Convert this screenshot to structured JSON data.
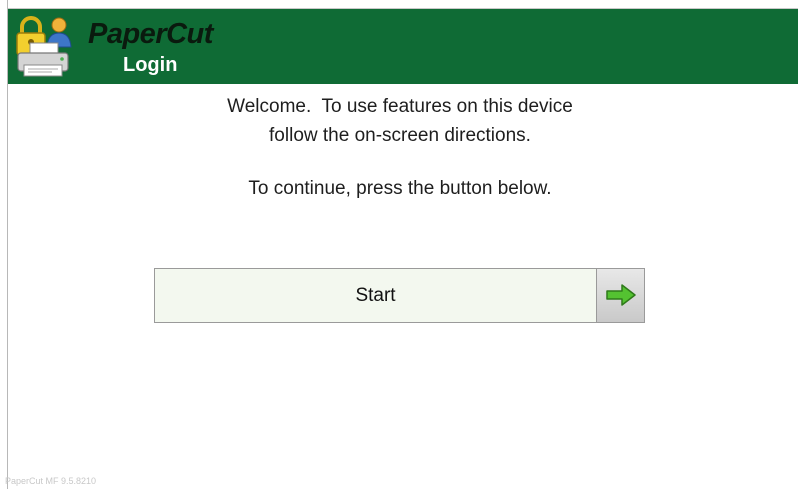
{
  "header": {
    "brand": "PaperCut",
    "title": "Login",
    "logo_icon": "papercut-printer-logo-icon"
  },
  "main": {
    "welcome_line1": "Welcome.  To use features on this device",
    "welcome_line2": "follow the on-screen directions.",
    "continue_text": "To continue, press the button below.",
    "start_label": "Start",
    "arrow_icon": "green-right-arrow-icon"
  },
  "footer": {
    "version": "PaperCut MF 9.5.8210"
  },
  "colors": {
    "header_bg": "#0f6b35",
    "button_bg": "#f3f8ef",
    "arrow": "#54c231"
  }
}
